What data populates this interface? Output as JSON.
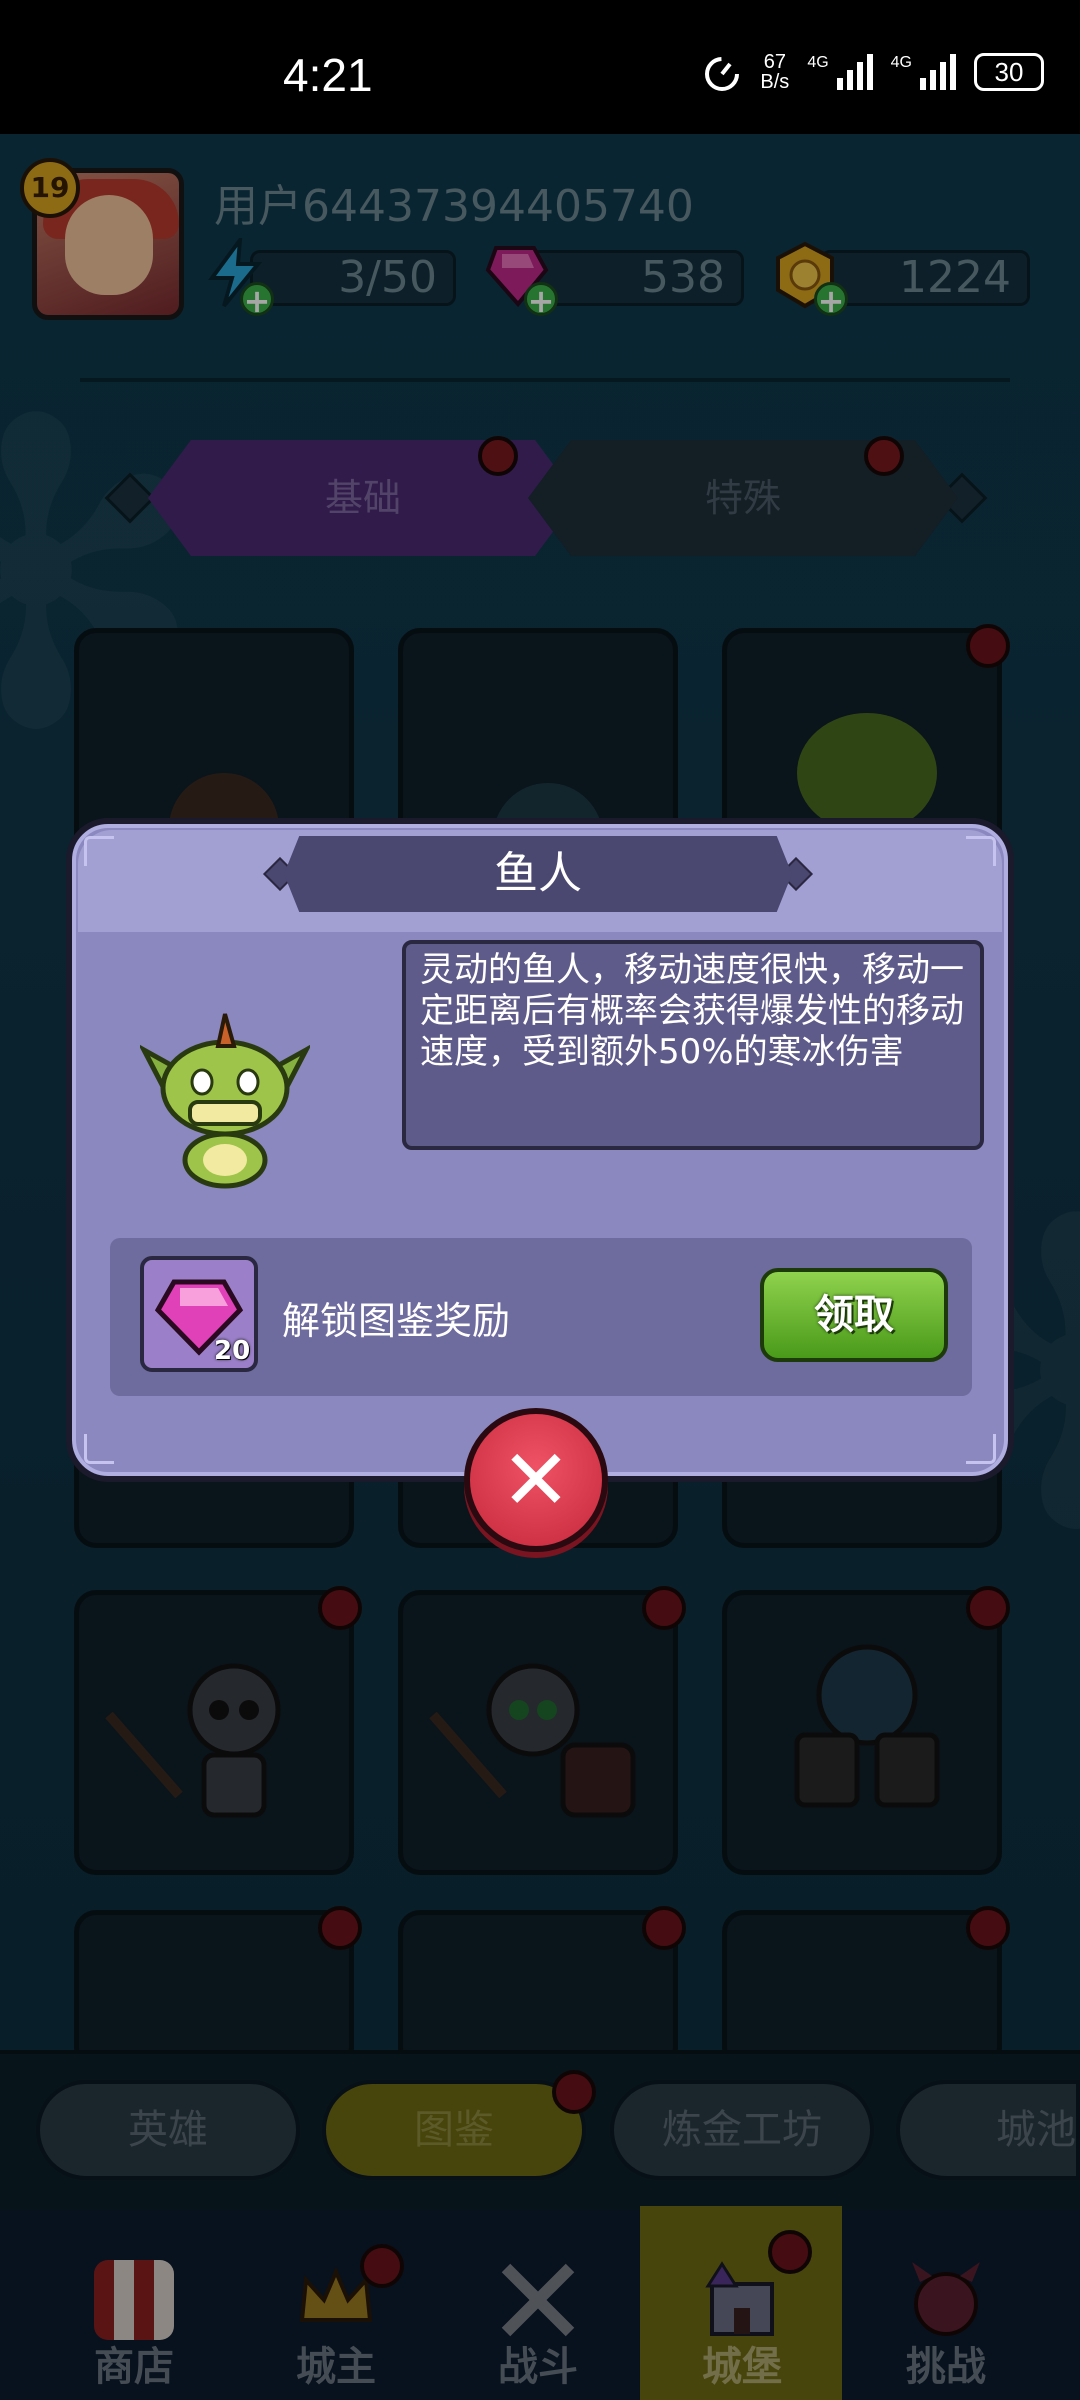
{
  "status_bar": {
    "time": "4:21",
    "net_speed_value": "67",
    "net_speed_unit": "B/s",
    "signal1_label": "4G",
    "signal2_label": "4G",
    "battery": "30"
  },
  "hud": {
    "level": "19",
    "username": "用户64437394405740",
    "energy": "3/50",
    "gems": "538",
    "coins": "1224"
  },
  "tabs": {
    "basic": "基础",
    "special": "特殊",
    "active": "basic"
  },
  "dialog": {
    "title": "鱼人",
    "description": "灵动的鱼人，移动速度很快，移动一定距离后有概率会获得爆发性的移动速度，受到额外50%的寒冰伤害",
    "reward_label": "解锁图鉴奖励",
    "reward_count": "20",
    "reward_icon": "gem-icon",
    "claim_label": "领取",
    "close_icon": "close-icon"
  },
  "sub_tabs": [
    {
      "label": "英雄"
    },
    {
      "label": "图鉴"
    },
    {
      "label": "炼金工坊"
    },
    {
      "label": "城池"
    }
  ],
  "active_sub_tab": "图鉴",
  "bottom_nav": [
    {
      "label": "商店"
    },
    {
      "label": "城主"
    },
    {
      "label": "战斗"
    },
    {
      "label": "城堡"
    },
    {
      "label": "挑战"
    }
  ],
  "active_nav": "城堡",
  "colors": {
    "claim_button": "#7cc23a",
    "close_button": "#e03a4e",
    "dialog_bg": "#8a88bf",
    "active_tab": "#6e6a13"
  }
}
